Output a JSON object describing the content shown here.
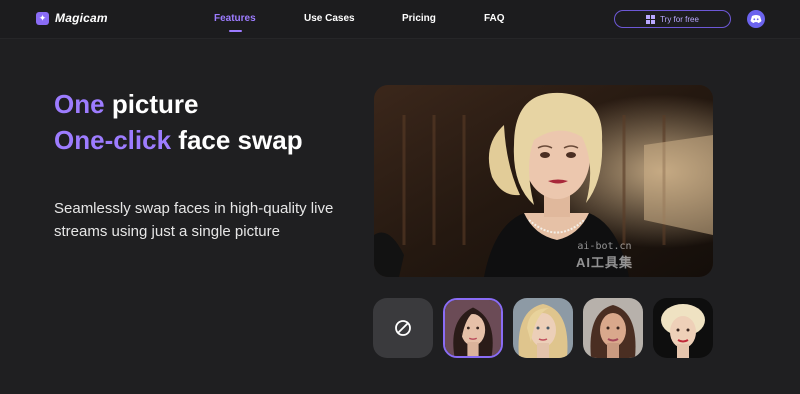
{
  "brand": {
    "name": "Magicam",
    "logo_icon": "magic-wand-icon"
  },
  "nav": {
    "items": [
      {
        "label": "Features",
        "active": true
      },
      {
        "label": "Use Cases",
        "active": false
      },
      {
        "label": "Pricing",
        "active": false
      },
      {
        "label": "FAQ",
        "active": false
      }
    ]
  },
  "header_actions": {
    "try_label": "Try for free",
    "try_icon": "windows-icon",
    "discord_icon": "discord-icon"
  },
  "hero": {
    "line1_accent": "One",
    "line1_rest": "picture",
    "line2_accent": "One-click",
    "line2_rest": "face swap",
    "subtitle": "Seamlessly swap faces in high-quality live streams using just a single picture"
  },
  "preview": {
    "watermark_line1": "ai-bot.cn",
    "watermark_line2": "AI工具集"
  },
  "face_options": [
    {
      "icon": "no-face-icon",
      "selected": false
    },
    {
      "selected": true
    },
    {
      "selected": false
    },
    {
      "selected": false
    },
    {
      "selected": false
    }
  ],
  "colors": {
    "background": "#1f1f21",
    "accent": "#9d7cff",
    "discord": "#6b63ee"
  }
}
